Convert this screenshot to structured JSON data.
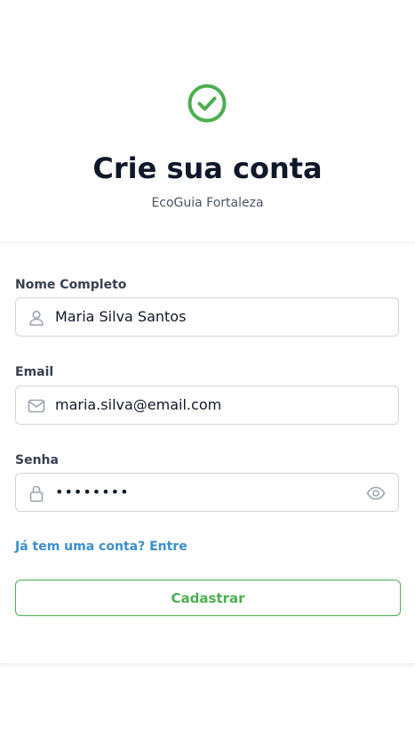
{
  "app": {
    "title": "Crie sua conta",
    "subtitle": "EcoGuia Fortaleza",
    "logo_icon": "check-circle-icon",
    "brand_color": "#4caf50"
  },
  "form": {
    "name": {
      "label": "Nome Completo",
      "value": "Maria Silva Santos",
      "icon": "user-icon"
    },
    "email": {
      "label": "Email",
      "value": "maria.silva@email.com",
      "icon": "mail-icon"
    },
    "password": {
      "label": "Senha",
      "value": "••••••••",
      "icon": "lock-icon",
      "toggle_icon": "eye-icon"
    },
    "login_link": "Já tem uma conta? Entre",
    "submit_label": "Cadastrar",
    "link_color": "#3b8fd0"
  }
}
